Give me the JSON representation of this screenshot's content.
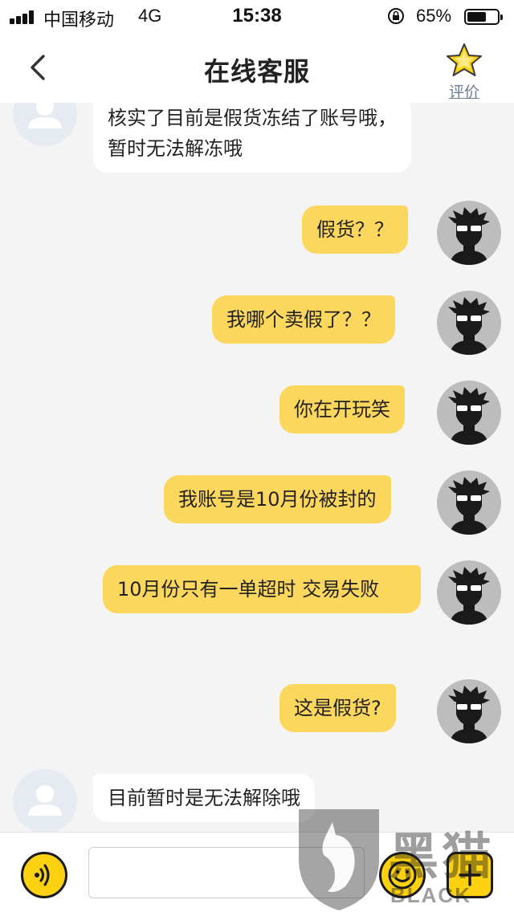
{
  "status_bar": {
    "carrier": "中国移动",
    "network": "4G",
    "time": "15:38",
    "battery_percent": "65%",
    "battery_level": 0.65
  },
  "nav": {
    "title": "在线客服",
    "back_icon": "chevron-left-icon",
    "rate_label": "评价",
    "rate_icon": "star-icon"
  },
  "messages": [
    {
      "sender": "agent",
      "text": "核实了目前是假货冻结了账号哦，暂时无法解冻哦"
    },
    {
      "sender": "user",
      "text": "假货？？"
    },
    {
      "sender": "user",
      "text": "我哪个卖假了？？"
    },
    {
      "sender": "user",
      "text": "你在开玩笑"
    },
    {
      "sender": "user",
      "text": "我账号是10月份被封的"
    },
    {
      "sender": "user",
      "text": "10月份只有一单超时 交易失败"
    },
    {
      "sender": "user",
      "text": "这是假货?"
    },
    {
      "sender": "agent",
      "text": "目前暂时是无法解除哦"
    }
  ],
  "input_bar": {
    "voice_icon": "voice-icon",
    "text_value": "",
    "emoji_icon": "emoji-icon",
    "more_icon": "plus-icon"
  },
  "watermark": {
    "text_cn": "黑猫",
    "text_en": "BLACK CAT"
  },
  "colors": {
    "user_bubble": "#fcd75e",
    "agent_bubble": "#ffffff",
    "background": "#f4f4f4",
    "accent": "#fcd210"
  }
}
